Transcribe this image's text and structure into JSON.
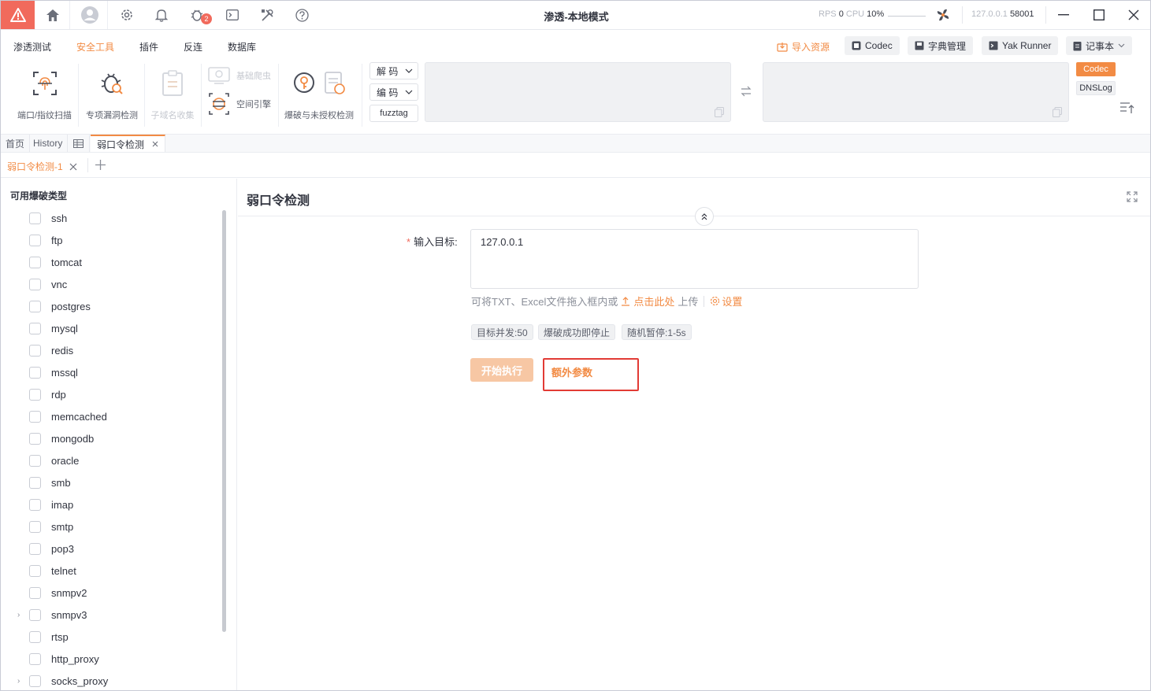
{
  "window": {
    "title": "渗透-本地模式",
    "rps_label": "RPS",
    "rps_value": "0",
    "cpu_label": "CPU",
    "cpu_value": "10%",
    "address": "127.0.0.1",
    "port": "58001",
    "badge_count": "2"
  },
  "menu": [
    "渗透测试",
    "安全工具",
    "插件",
    "反连",
    "数据库"
  ],
  "menu_active_index": 1,
  "right_actions": {
    "import": "导入资源",
    "codec": "Codec",
    "dict": "字典管理",
    "yak_runner": "Yak Runner",
    "notepad": "记事本"
  },
  "tools": {
    "port_scan": "端口/指纹扫描",
    "vuln": "专项漏洞检测",
    "subdomain": "子域名收集",
    "crawler": "基础爬虫",
    "space_engine": "空间引擎",
    "brute": "爆破与未授权检测"
  },
  "codec": {
    "decode": "解 码",
    "encode": "编 码",
    "fuzztag": "fuzztag",
    "side_codec": "Codec",
    "side_dnslog": "DNSLog"
  },
  "tabs_top": {
    "home": "首页",
    "history": "History",
    "active": "弱口令检测"
  },
  "tabs_sub": {
    "active": "弱口令检测-1"
  },
  "left": {
    "title": "可用爆破类型",
    "items": [
      "ssh",
      "ftp",
      "tomcat",
      "vnc",
      "postgres",
      "mysql",
      "redis",
      "mssql",
      "rdp",
      "memcached",
      "mongodb",
      "oracle",
      "smb",
      "imap",
      "smtp",
      "pop3",
      "telnet",
      "snmpv2",
      "snmpv3",
      "rtsp",
      "http_proxy",
      "socks_proxy"
    ]
  },
  "right": {
    "title": "弱口令检测",
    "target_label": "输入目标:",
    "target_value": "127.0.0.1",
    "hint_prefix": "可将TXT、Excel文件拖入框内或",
    "hint_link": "点击此处",
    "hint_suffix": "上传",
    "settings": "设置",
    "tags": [
      "目标并发:50",
      "爆破成功即停止",
      "随机暂停:1-5s"
    ],
    "run": "开始执行",
    "extra": "额外参数"
  },
  "colors": {
    "accent": "#f28b44",
    "logo": "#f16a5c",
    "highlight_border": "#e23b35"
  }
}
